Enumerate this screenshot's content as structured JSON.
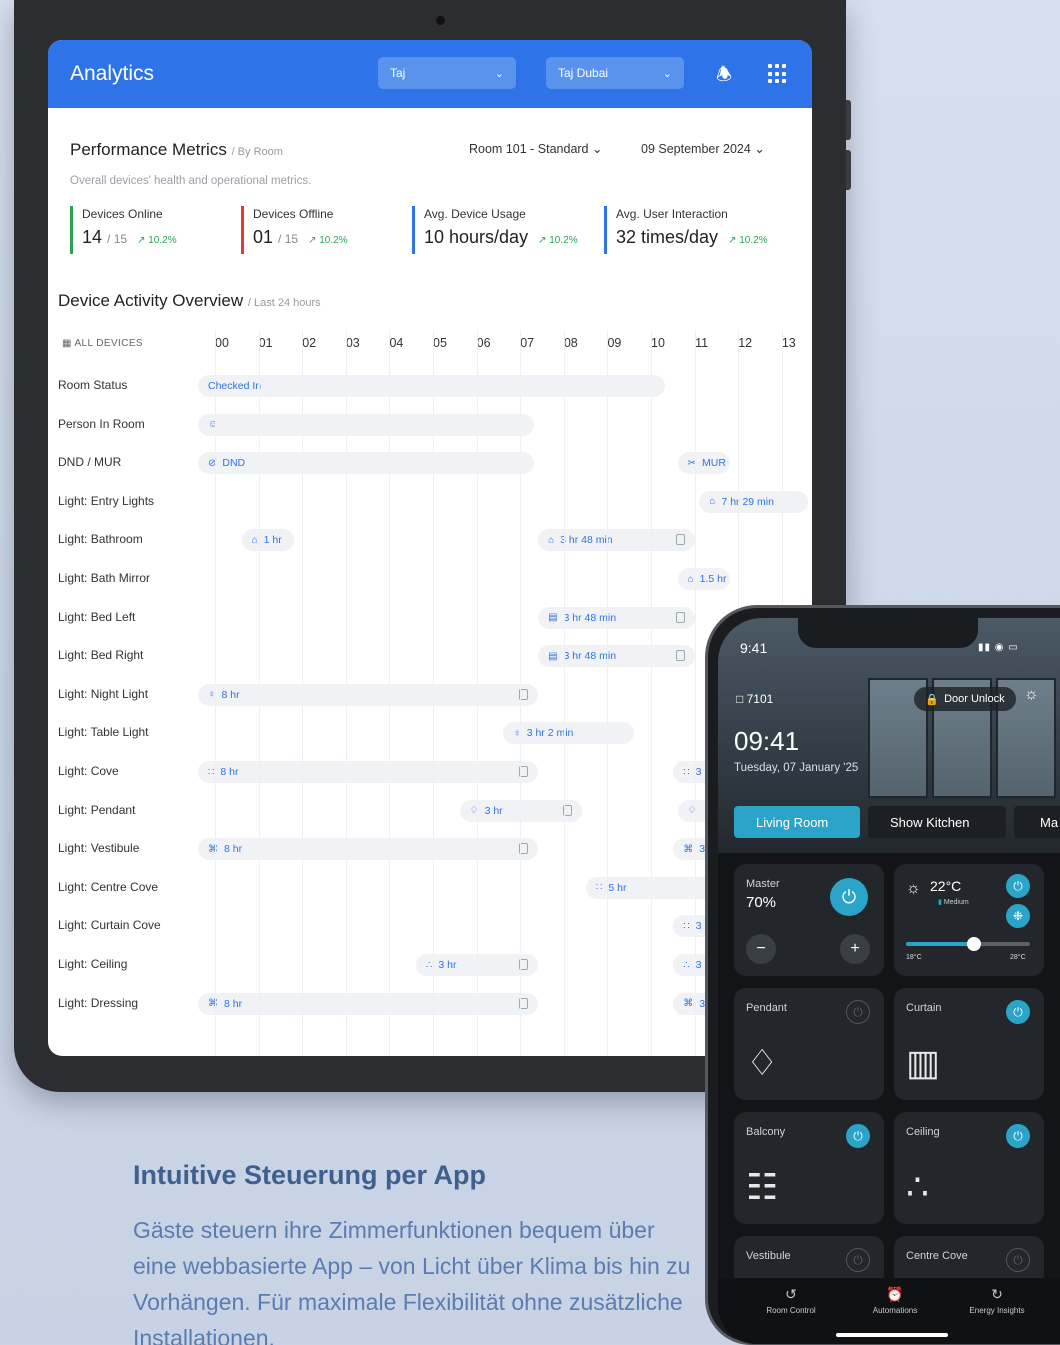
{
  "dashboard": {
    "title": "Analytics",
    "property_select": "Taj",
    "hotel_select": "Taj Dubai",
    "perf_title": "Performance Metrics",
    "perf_subtitle": "/ By Room",
    "perf_desc": "Overall devices' health and operational metrics.",
    "room_select": "Room 101 - Standard",
    "date_select": "09 September 2024",
    "metrics": [
      {
        "label": "Devices Online",
        "value": "14",
        "of": "/ 15",
        "trend": "10.2%",
        "color": "#2aa556"
      },
      {
        "label": "Devices Offline",
        "value": "01",
        "of": "/ 15",
        "trend": "10.2%",
        "color": "#e53935"
      },
      {
        "label": "Avg. Device Usage",
        "value": "10 hours/day",
        "of": "",
        "trend": "10.2%",
        "color": "#2e73e8"
      },
      {
        "label": "Avg. User Interaction",
        "value": "32 times/day",
        "of": "",
        "trend": "10.2%",
        "color": "#2e73e8"
      }
    ],
    "activity_title": "Device Activity Overview",
    "activity_subtitle": "/ Last 24 hours",
    "all_devices": "ALL DEVICES",
    "hours": [
      "00",
      "01",
      "02",
      "03",
      "04",
      "05",
      "06",
      "07",
      "08",
      "09",
      "10",
      "11",
      "12",
      "13"
    ],
    "rows": [
      {
        "label": "Room Status",
        "bars": [
          {
            "start": 0,
            "end": 10.7,
            "text": "Checked In",
            "icon": ""
          }
        ]
      },
      {
        "label": "Person In Room",
        "bars": [
          {
            "start": 0,
            "end": 7.7,
            "text": "",
            "icon": "person-check-icon"
          }
        ]
      },
      {
        "label": "DND / MUR",
        "bars": [
          {
            "start": 0,
            "end": 7.7,
            "text": "DND",
            "icon": "dnd-icon"
          },
          {
            "start": 11,
            "end": 12.2,
            "text": "MUR",
            "icon": "broom-icon"
          }
        ]
      },
      {
        "label": "Light: Entry Lights",
        "bars": [
          {
            "start": 11.5,
            "end": 14,
            "text": "7 hr 29 min",
            "icon": "lamp-icon"
          }
        ]
      },
      {
        "label": "Light: Bathroom",
        "bars": [
          {
            "start": 1,
            "end": 2.2,
            "text": "1 hr",
            "icon": "lamp-icon"
          },
          {
            "start": 7.8,
            "end": 11.4,
            "text": "3 hr 48 min",
            "icon": "lamp-icon",
            "end_icon": true
          }
        ]
      },
      {
        "label": "Light: Bath Mirror",
        "bars": [
          {
            "start": 11,
            "end": 12.2,
            "text": "1.5 hr",
            "icon": "lamp-icon"
          }
        ]
      },
      {
        "label": "Light: Bed Left",
        "bars": [
          {
            "start": 7.8,
            "end": 11.4,
            "text": "3 hr 48 min",
            "icon": "bed-icon",
            "end_icon": true
          }
        ]
      },
      {
        "label": "Light: Bed Right",
        "bars": [
          {
            "start": 7.8,
            "end": 11.4,
            "text": "3 hr 48 min",
            "icon": "bed-icon",
            "end_icon": true
          }
        ]
      },
      {
        "label": "Light: Night Light",
        "bars": [
          {
            "start": 0,
            "end": 7.8,
            "text": "8 hr",
            "icon": "bulb-icon",
            "end_icon": true
          }
        ]
      },
      {
        "label": "Light: Table Light",
        "bars": [
          {
            "start": 7,
            "end": 10,
            "text": "3 hr 2 min",
            "icon": "bulb-icon"
          }
        ]
      },
      {
        "label": "Light: Cove",
        "bars": [
          {
            "start": 0,
            "end": 7.8,
            "text": "8 hr",
            "icon": "cove-icon",
            "end_icon": true
          },
          {
            "start": 10.9,
            "end": 12.2,
            "text": "3 hr",
            "icon": "cove-icon"
          }
        ]
      },
      {
        "label": "Light: Pendant",
        "bars": [
          {
            "start": 6,
            "end": 8.8,
            "text": "3 hr",
            "icon": "pendant-icon",
            "end_icon": true
          },
          {
            "start": 11,
            "end": 12.2,
            "text": "",
            "icon": "pendant-icon"
          }
        ]
      },
      {
        "label": "Light: Vestibule",
        "bars": [
          {
            "start": 0,
            "end": 7.8,
            "text": "8 hr",
            "icon": "spot-icon",
            "end_icon": true
          },
          {
            "start": 10.9,
            "end": 12.2,
            "text": "3 hr",
            "icon": "spot-icon"
          }
        ]
      },
      {
        "label": "Light: Centre Cove",
        "bars": [
          {
            "start": 8.9,
            "end": 12.2,
            "text": "5 hr",
            "icon": "cove-icon"
          }
        ]
      },
      {
        "label": "Light: Curtain Cove",
        "bars": [
          {
            "start": 10.9,
            "end": 12.2,
            "text": "3 hr",
            "icon": "cove-icon"
          }
        ]
      },
      {
        "label": "Light: Ceiling",
        "bars": [
          {
            "start": 5,
            "end": 7.8,
            "text": "3 hr",
            "icon": "ceiling-icon",
            "end_icon": true
          },
          {
            "start": 10.9,
            "end": 12.2,
            "text": "3 hr",
            "icon": "ceiling-icon"
          }
        ]
      },
      {
        "label": "Light: Dressing",
        "bars": [
          {
            "start": 0,
            "end": 7.8,
            "text": "8 hr",
            "icon": "spot-icon",
            "end_icon": true
          },
          {
            "start": 10.9,
            "end": 12.2,
            "text": "3 hr",
            "icon": "spot-icon"
          }
        ]
      }
    ]
  },
  "phone": {
    "status_time": "9:41",
    "room_number": "7101",
    "door_unlock": "Door Unlock",
    "clock": "09:41",
    "date": "Tuesday, 07 January '25",
    "tabs": [
      "Living Room",
      "Show Kitchen",
      "Ma"
    ],
    "master_label": "Master",
    "master_value": "70%",
    "ac_temp": "22°C",
    "ac_fan": "Medium",
    "ac_level": 0.55,
    "slider_min": "18°C",
    "slider_max": "28°C",
    "cards": [
      {
        "label": "Pendant",
        "on": false,
        "icon": "pendant-lamp-icon"
      },
      {
        "label": "Curtain",
        "on": true,
        "icon": "curtain-icon"
      },
      {
        "label": "Balcony",
        "on": true,
        "icon": "balcony-light-icon"
      },
      {
        "label": "Ceiling",
        "on": true,
        "icon": "ceiling-light-icon"
      },
      {
        "label": "Vestibule",
        "on": false,
        "icon": ""
      },
      {
        "label": "Centre Cove",
        "on": false,
        "icon": ""
      }
    ],
    "nav": [
      {
        "label": "Room Control",
        "icon": "room-control-icon"
      },
      {
        "label": "Automations",
        "icon": "alarm-icon"
      },
      {
        "label": "Energy Insights",
        "icon": "energy-icon"
      }
    ]
  },
  "marketing": {
    "heading": "Intuitive Steuerung per App",
    "body": "Gäste steuern ihre Zimmerfunktionen bequem über eine webbasierte App – von Licht über Klima bis hin zu Vorhängen. Für maximale Flexibilität ohne zusätzliche Installationen."
  }
}
